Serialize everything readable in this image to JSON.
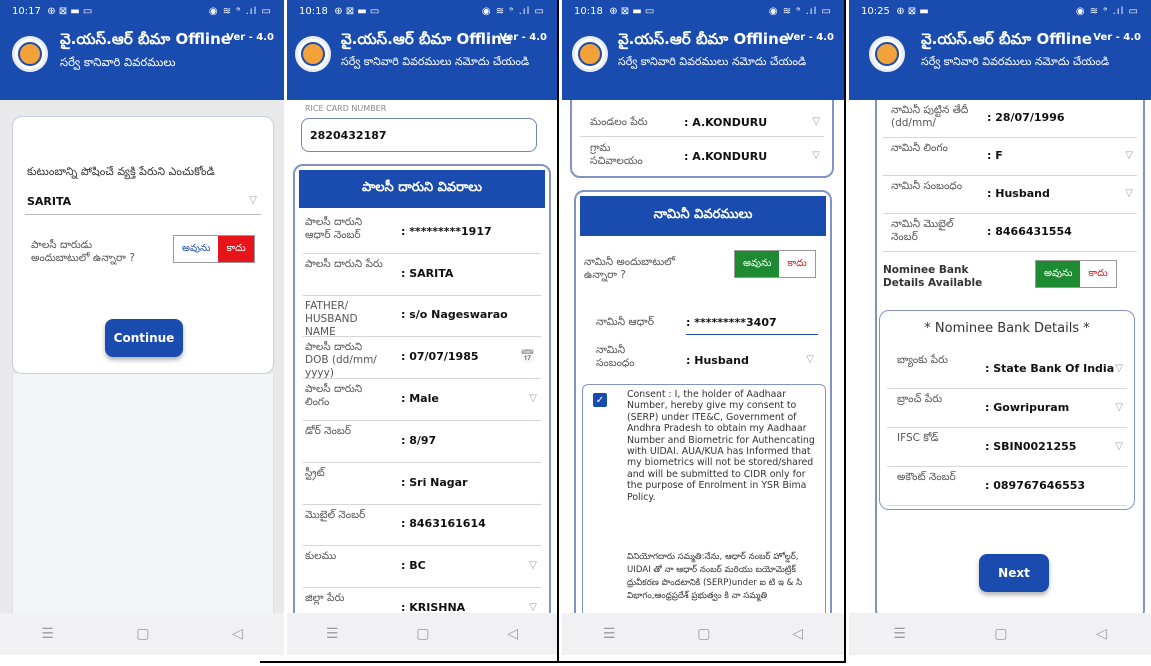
{
  "app": {
    "title": "వై.యస్.ఆర్ బీమా Offline",
    "version": "Ver - 4.0",
    "accent": "#1a4cb0"
  },
  "screens": [
    {
      "status_time": "10:17",
      "status_icons_left": "⊕ ⊠ ▬ ▭",
      "status_icons_right": "◉ ≋ ᵊ .ıl ▭",
      "subtitle": "సర్వే కానివారి వివరములు",
      "prompt": "కుటుంబాన్ని పోషించే వ్యక్తి పేరుని ఎంచుకోండి",
      "selected_person": "SARITA",
      "question": "పాలసీ దారుడు అందుబాటులో ఉన్నారా ?",
      "yes": "అవును",
      "no": "కాదు",
      "continue": "Continue"
    },
    {
      "status_time": "10:18",
      "status_icons_left": "⊕ ⊠ ▬ ▭",
      "status_icons_right": "◉ ≋ ᵊ .ıl ▭",
      "subtitle": "సర్వే కానివారి వివరములు నమోదు చేయండి",
      "rice_label": "RICE CARD NUMBER",
      "rice_value": "2820432187",
      "section": "పాలసీ దారుని వివరాలు",
      "fields": [
        {
          "label": "పాలసీ దారుని ఆధార్ నెంబర్",
          "value": "*********1917"
        },
        {
          "label": "పాలసీ దారుని పేరు",
          "value": "SARITA"
        },
        {
          "label": "FATHER/ HUSBAND NAME",
          "value": "s/o Nageswarao"
        },
        {
          "label": "పాలసీ దారుని DOB (dd/mm/ yyyy)",
          "value": "07/07/1985"
        },
        {
          "label": "పాలసీ దారుని లింగం",
          "value": "Male"
        },
        {
          "label": "డోర్ నెంబర్",
          "value": "8/97"
        },
        {
          "label": "స్ట్రీట్",
          "value": "Sri Nagar"
        },
        {
          "label": "మొబైల్ నెంబర్",
          "value": "8463161614"
        },
        {
          "label": "కులము",
          "value": "BC"
        },
        {
          "label": "జిల్లా పేరు",
          "value": "KRISHNA"
        }
      ]
    },
    {
      "status_time": "10:18",
      "status_icons_left": "⊕ ⊠ ▬ ▭",
      "status_icons_right": "◉ ≋ ᵊ .ıl ▭",
      "subtitle": "సర్వే కానివారి వివరములు నమోదు చేయండి",
      "mandal_label": "మండలం పేరు",
      "mandal_value": "A.KONDURU",
      "village_label": "గ్రామ సచివాలయం",
      "village_value": "A.KONDURU",
      "section": "నామినీ వివరములు",
      "nominee_available": "నామినీ అందుబాటులో ఉన్నారా ?",
      "yes": "అవును",
      "no": "కాదు",
      "nominee_aadhaar_label": "నామినీ ఆధార్",
      "nominee_aadhaar_value": "*********3407",
      "relation_label": "నామినీ సంబంధం",
      "relation_value": "Husband",
      "consent_en": "Consent : I, the holder of Aadhaar Number, hereby give my consent to (SERP) under ITE&C, Government of Andhra Pradesh to obtain my Aadhaar Number and Biometric for Authencating with UIDAI. AUA/KUA has Informed that my biometrics will not be stored/shared and will be submitted to CIDR only for the purpose of Enrolment in YSR Bima Policy.",
      "consent_te": "వినియోగదారు సమ్మతి:నేను, ఆధార్ నంబర్ హోల్డర్, UIDAI తో నా ఆధార్ నంబర్ మరియు బయోమెట్రిక్ ధ్రువీకరణ పొందటానికి (SERP)under ఐ టి ఇ & సి విభాగం,ఆంధ్రప్రదేశ్ ప్రభుత్వం కి నా సమ్మతి"
    },
    {
      "status_time": "10:25",
      "status_icons_left": "⊕ ⊠ ▬",
      "status_icons_right": "◉ ≋ ᵊ .ıl ▭",
      "subtitle": "సర్వే కానివారి వివరములు నమోదు చేయండి",
      "fields": [
        {
          "label": "నామినీ పుట్టిన తేదీ (dd/mm/",
          "value": "28/07/1996"
        },
        {
          "label": "నామినీ లింగం",
          "value": "F"
        },
        {
          "label": "నామినీ సంబంధం",
          "value": "Husband"
        },
        {
          "label": "నామినీ మొబైల్ నెంబర్",
          "value": "8466431554"
        }
      ],
      "bank_available": "Nominee Bank Details Available",
      "yes": "అవును",
      "no": "కాదు",
      "bank_title": "* Nominee Bank Details *",
      "bank_fields": [
        {
          "label": "బ్యాంకు పేరు",
          "value": "State Bank Of India"
        },
        {
          "label": "బ్రాంచ్ పేరు",
          "value": "Gowripuram"
        },
        {
          "label": "IFSC కోడ్",
          "value": "SBIN0021255"
        },
        {
          "label": "అకౌంట్ నెంబర్",
          "value": "089767646553"
        }
      ],
      "next": "Next"
    }
  ]
}
